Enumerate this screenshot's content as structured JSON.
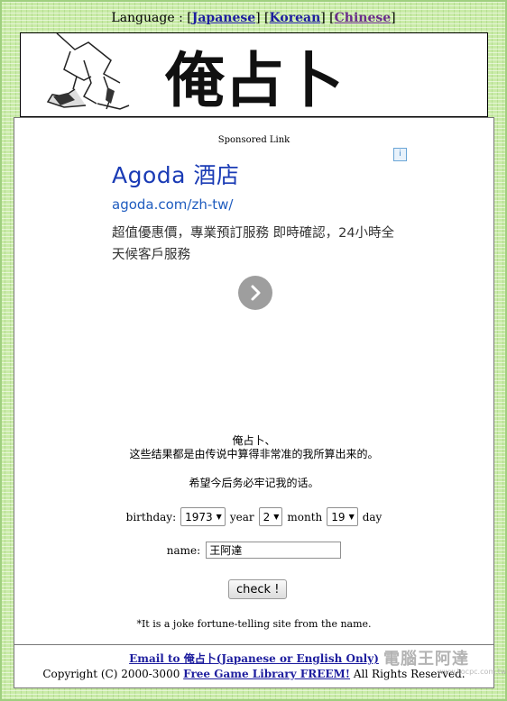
{
  "lang_bar": {
    "prefix": "Language : [",
    "japanese": "Japanese",
    "sep1": "] [",
    "korean": "Korean",
    "sep2": "] [",
    "chinese": "Chinese",
    "suffix": "]"
  },
  "banner": {
    "title": "俺占卜"
  },
  "ad": {
    "sponsored_label": "Sponsored Link",
    "info_glyph": "i",
    "title": "Agoda 酒店",
    "url": "agoda.com/zh-tw/",
    "description": "超值優惠價，專業預訂服務 即時確認，24小時全天候客戶服務",
    "arrow_icon": "chevron-right-icon"
  },
  "intro": {
    "line1": "俺占卜、",
    "line2": "这些结果都是由传说中算得非常准的我所算出来的。",
    "line3": "希望今后务必牢记我的话。"
  },
  "form": {
    "birthday_label": "birthday:",
    "year_value": "1973",
    "year_label": "year",
    "month_value": "2",
    "month_label": "month",
    "day_value": "19",
    "day_label": "day",
    "name_label": "name:",
    "name_value": "王阿達",
    "check_button": "check !"
  },
  "joke_note": "*It is a joke fortune-telling site from the name.",
  "footer": {
    "email_text": "Email to 俺占卜(Japanese or English Only)",
    "copyright_prefix": "Copyright (C) 2000-3000 ",
    "copyright_link": "Free Game Library FREEM!",
    "copyright_suffix": " All Rights Reserved."
  },
  "watermark": {
    "text": "電腦王阿達",
    "url": "www.kocpc.com.tw"
  }
}
